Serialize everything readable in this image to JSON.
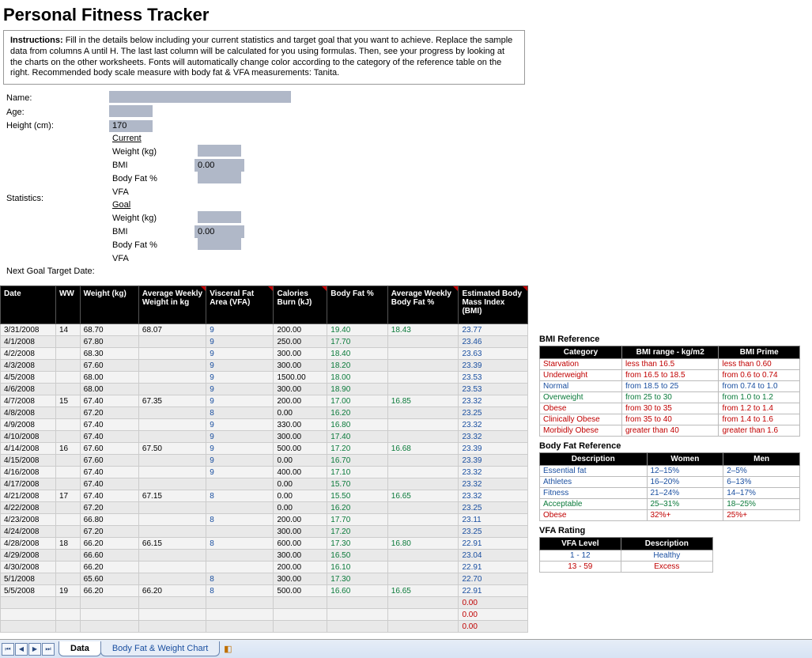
{
  "title": "Personal Fitness Tracker",
  "instructions": {
    "label": "Instructions:",
    "text": "Fill in the details below including your current statistics and target goal that you want to achieve. Replace the sample data from columns A until H. The last last column will be calculated for you using formulas. Then, see your progress by looking at the charts on the other worksheets. Fonts will automatically change color according to the category of the reference table on the right. Recommended body scale measure with body fat & VFA measurements: Tanita."
  },
  "profile": {
    "name_label": "Name:",
    "age_label": "Age:",
    "height_label": "Height (cm):",
    "height_value": "170",
    "stats_label": "Statistics:",
    "current_header": "Current",
    "goal_header": "Goal",
    "weight_label": "Weight (kg)",
    "bmi_label": "BMI",
    "bmi_current": "0.00",
    "bmi_goal": "0.00",
    "bodyfat_label": "Body Fat %",
    "vfa_label": "VFA",
    "next_goal_label": "Next Goal Target Date:"
  },
  "columns": {
    "date": "Date",
    "ww": "WW",
    "weight": "Weight (kg)",
    "avg_weight": "Average Weekly Weight in kg",
    "vfa": "Visceral Fat Area (VFA)",
    "calories": "Calories Burn (kJ)",
    "bodyfat": "Body Fat %",
    "avg_bf": "Average Weekly Body Fat %",
    "bmi": "Estimated Body Mass Index (BMI)"
  },
  "rows": [
    {
      "date": "3/31/2008",
      "ww": "14",
      "weight": "68.70",
      "avgw": "68.07",
      "vfa": "9",
      "cal": "200.00",
      "bf": "19.40",
      "avgbf": "18.43",
      "bmi": "23.77"
    },
    {
      "date": "4/1/2008",
      "ww": "",
      "weight": "67.80",
      "avgw": "",
      "vfa": "9",
      "cal": "250.00",
      "bf": "17.70",
      "avgbf": "",
      "bmi": "23.46"
    },
    {
      "date": "4/2/2008",
      "ww": "",
      "weight": "68.30",
      "avgw": "",
      "vfa": "9",
      "cal": "300.00",
      "bf": "18.40",
      "avgbf": "",
      "bmi": "23.63"
    },
    {
      "date": "4/3/2008",
      "ww": "",
      "weight": "67.60",
      "avgw": "",
      "vfa": "9",
      "cal": "300.00",
      "bf": "18.20",
      "avgbf": "",
      "bmi": "23.39"
    },
    {
      "date": "4/5/2008",
      "ww": "",
      "weight": "68.00",
      "avgw": "",
      "vfa": "9",
      "cal": "1500.00",
      "bf": "18.00",
      "avgbf": "",
      "bmi": "23.53"
    },
    {
      "date": "4/6/2008",
      "ww": "",
      "weight": "68.00",
      "avgw": "",
      "vfa": "9",
      "cal": "300.00",
      "bf": "18.90",
      "avgbf": "",
      "bmi": "23.53"
    },
    {
      "date": "4/7/2008",
      "ww": "15",
      "weight": "67.40",
      "avgw": "67.35",
      "vfa": "9",
      "cal": "200.00",
      "bf": "17.00",
      "avgbf": "16.85",
      "bmi": "23.32"
    },
    {
      "date": "4/8/2008",
      "ww": "",
      "weight": "67.20",
      "avgw": "",
      "vfa": "8",
      "cal": "0.00",
      "bf": "16.20",
      "avgbf": "",
      "bmi": "23.25"
    },
    {
      "date": "4/9/2008",
      "ww": "",
      "weight": "67.40",
      "avgw": "",
      "vfa": "9",
      "cal": "330.00",
      "bf": "16.80",
      "avgbf": "",
      "bmi": "23.32"
    },
    {
      "date": "4/10/2008",
      "ww": "",
      "weight": "67.40",
      "avgw": "",
      "vfa": "9",
      "cal": "300.00",
      "bf": "17.40",
      "avgbf": "",
      "bmi": "23.32"
    },
    {
      "date": "4/14/2008",
      "ww": "16",
      "weight": "67.60",
      "avgw": "67.50",
      "vfa": "9",
      "cal": "500.00",
      "bf": "17.20",
      "avgbf": "16.68",
      "bmi": "23.39"
    },
    {
      "date": "4/15/2008",
      "ww": "",
      "weight": "67.60",
      "avgw": "",
      "vfa": "9",
      "cal": "0.00",
      "bf": "16.70",
      "avgbf": "",
      "bmi": "23.39"
    },
    {
      "date": "4/16/2008",
      "ww": "",
      "weight": "67.40",
      "avgw": "",
      "vfa": "9",
      "cal": "400.00",
      "bf": "17.10",
      "avgbf": "",
      "bmi": "23.32"
    },
    {
      "date": "4/17/2008",
      "ww": "",
      "weight": "67.40",
      "avgw": "",
      "vfa": "",
      "cal": "0.00",
      "bf": "15.70",
      "avgbf": "",
      "bmi": "23.32"
    },
    {
      "date": "4/21/2008",
      "ww": "17",
      "weight": "67.40",
      "avgw": "67.15",
      "vfa": "8",
      "cal": "0.00",
      "bf": "15.50",
      "avgbf": "16.65",
      "bmi": "23.32"
    },
    {
      "date": "4/22/2008",
      "ww": "",
      "weight": "67.20",
      "avgw": "",
      "vfa": "",
      "cal": "0.00",
      "bf": "16.20",
      "avgbf": "",
      "bmi": "23.25"
    },
    {
      "date": "4/23/2008",
      "ww": "",
      "weight": "66.80",
      "avgw": "",
      "vfa": "8",
      "cal": "200.00",
      "bf": "17.70",
      "avgbf": "",
      "bmi": "23.11"
    },
    {
      "date": "4/24/2008",
      "ww": "",
      "weight": "67.20",
      "avgw": "",
      "vfa": "",
      "cal": "300.00",
      "bf": "17.20",
      "avgbf": "",
      "bmi": "23.25"
    },
    {
      "date": "4/28/2008",
      "ww": "18",
      "weight": "66.20",
      "avgw": "66.15",
      "vfa": "8",
      "cal": "600.00",
      "bf": "17.30",
      "avgbf": "16.80",
      "bmi": "22.91"
    },
    {
      "date": "4/29/2008",
      "ww": "",
      "weight": "66.60",
      "avgw": "",
      "vfa": "",
      "cal": "300.00",
      "bf": "16.50",
      "avgbf": "",
      "bmi": "23.04"
    },
    {
      "date": "4/30/2008",
      "ww": "",
      "weight": "66.20",
      "avgw": "",
      "vfa": "",
      "cal": "200.00",
      "bf": "16.10",
      "avgbf": "",
      "bmi": "22.91"
    },
    {
      "date": "5/1/2008",
      "ww": "",
      "weight": "65.60",
      "avgw": "",
      "vfa": "8",
      "cal": "300.00",
      "bf": "17.30",
      "avgbf": "",
      "bmi": "22.70"
    },
    {
      "date": "5/5/2008",
      "ww": "19",
      "weight": "66.20",
      "avgw": "66.20",
      "vfa": "8",
      "cal": "500.00",
      "bf": "16.60",
      "avgbf": "16.65",
      "bmi": "22.91"
    },
    {
      "date": "",
      "ww": "",
      "weight": "",
      "avgw": "",
      "vfa": "",
      "cal": "",
      "bf": "",
      "avgbf": "",
      "bmi": "0.00",
      "bmi_red": true
    },
    {
      "date": "",
      "ww": "",
      "weight": "",
      "avgw": "",
      "vfa": "",
      "cal": "",
      "bf": "",
      "avgbf": "",
      "bmi": "0.00",
      "bmi_red": true
    },
    {
      "date": "",
      "ww": "",
      "weight": "",
      "avgw": "",
      "vfa": "",
      "cal": "",
      "bf": "",
      "avgbf": "",
      "bmi": "0.00",
      "bmi_red": true
    }
  ],
  "bmi_ref": {
    "title": "BMI Reference",
    "headers": {
      "cat": "Category",
      "range": "BMI range - kg/m2",
      "prime": "BMI Prime"
    },
    "rows": [
      {
        "cat": "Starvation",
        "range": "less than 16.5",
        "prime": "less than 0.60",
        "color": "red"
      },
      {
        "cat": "Underweight",
        "range": "from 16.5 to 18.5",
        "prime": "from 0.6 to 0.74",
        "color": "red"
      },
      {
        "cat": "Normal",
        "range": "from 18.5 to 25",
        "prime": "from 0.74 to 1.0",
        "color": "blue"
      },
      {
        "cat": "Overweight",
        "range": "from 25 to 30",
        "prime": "from 1.0 to 1.2",
        "color": "green"
      },
      {
        "cat": "Obese",
        "range": "from 30 to 35",
        "prime": "from 1.2 to 1.4",
        "color": "red"
      },
      {
        "cat": "Clinically Obese",
        "range": "from 35 to 40",
        "prime": "from 1.4 to 1.6",
        "color": "red"
      },
      {
        "cat": "Morbidly Obese",
        "range": "greater than 40",
        "prime": "greater than 1.6",
        "color": "red"
      }
    ]
  },
  "bf_ref": {
    "title": "Body Fat Reference",
    "headers": {
      "desc": "Description",
      "women": "Women",
      "men": "Men"
    },
    "rows": [
      {
        "desc": "Essential fat",
        "women": "12–15%",
        "men": "2–5%",
        "color": "blue"
      },
      {
        "desc": "Athletes",
        "women": "16–20%",
        "men": "6–13%",
        "color": "blue"
      },
      {
        "desc": "Fitness",
        "women": "21–24%",
        "men": "14–17%",
        "color": "blue"
      },
      {
        "desc": "Acceptable",
        "women": "25–31%",
        "men": "18–25%",
        "color": "green"
      },
      {
        "desc": "Obese",
        "women": "32%+",
        "men": "25%+",
        "color": "red"
      }
    ]
  },
  "vfa_ref": {
    "title": "VFA Rating",
    "headers": {
      "level": "VFA Level",
      "desc": "Description"
    },
    "rows": [
      {
        "level": "1 - 12",
        "desc": "Healthy",
        "color": "blue"
      },
      {
        "level": "13 - 59",
        "desc": "Excess",
        "color": "red"
      }
    ]
  },
  "tabs": {
    "data": "Data",
    "chart": "Body Fat & Weight Chart"
  }
}
